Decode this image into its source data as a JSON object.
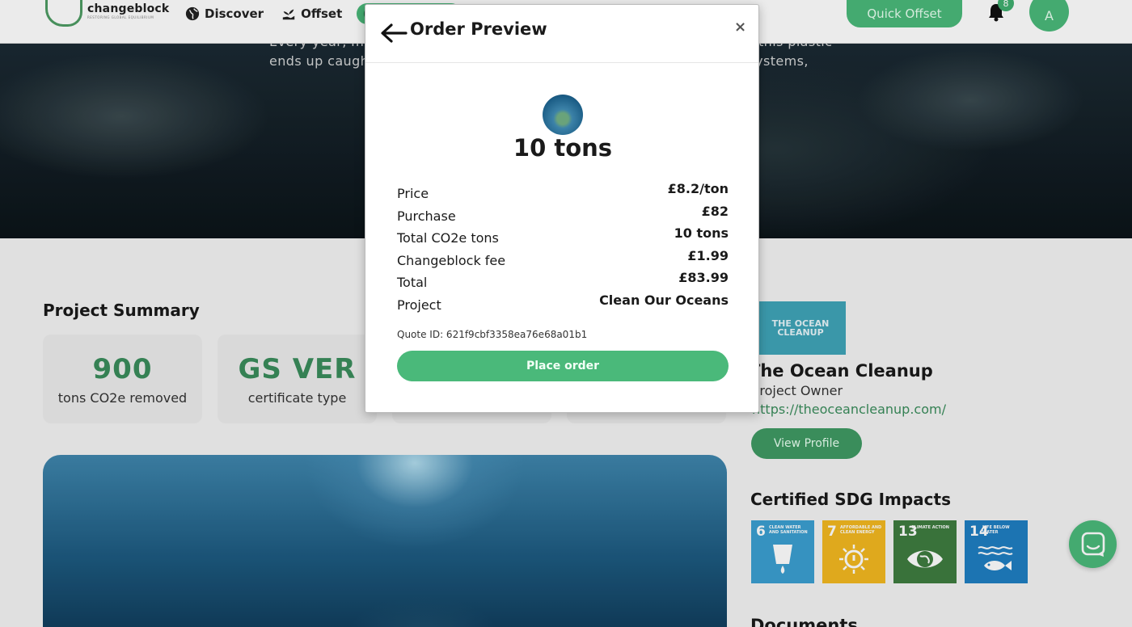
{
  "header": {
    "logo_name": "changeblock",
    "logo_tagline": "RESTORING GLOBAL EQUILIBRIUM",
    "nav": [
      {
        "label": "Discover",
        "icon": "globe-icon"
      },
      {
        "label": "Offset",
        "icon": "plant-hand-icon"
      }
    ],
    "quick_offset": "Quick Offset",
    "notification_count": "8",
    "avatar_initial": "A"
  },
  "hero": {
    "text": "Every year, millions of tons of plastic spills out from rivers. A portion of this plastic ends up caught in a vortex of circulating currents, threatening our ecosystems,"
  },
  "summary": {
    "title": "Project Summary",
    "stats": [
      {
        "value": "900",
        "label": "tons CO2e removed"
      },
      {
        "value": "GS VER",
        "label": "certificate type"
      },
      {
        "value": "",
        "label": ""
      },
      {
        "value": "",
        "label": ""
      }
    ]
  },
  "organization": {
    "logo_text": "THE OCEAN CLEANUP",
    "name": "The Ocean Cleanup",
    "role": "Project Owner",
    "url": "https://theoceancleanup.com/",
    "view_profile": "View Profile"
  },
  "sdg": {
    "title": "Certified SDG Impacts",
    "items": [
      {
        "number": "6",
        "label": "CLEAN WATER AND SANITATION",
        "color": "#3b9fd1",
        "icon": "water-drop-icon"
      },
      {
        "number": "7",
        "label": "AFFORDABLE AND CLEAN ENERGY",
        "color": "#f2b820",
        "icon": "sun-power-icon"
      },
      {
        "number": "13",
        "label": "CLIMATE ACTION",
        "color": "#3e7c3f",
        "icon": "eye-globe-icon"
      },
      {
        "number": "14",
        "label": "LIFE BELOW WATER",
        "color": "#1f7ec2",
        "icon": "fish-icon"
      }
    ]
  },
  "documents": {
    "title": "Documents"
  },
  "modal": {
    "title": "Order Preview",
    "close": "×",
    "tons": "10 tons",
    "rows": [
      {
        "label": "Price",
        "value": "£8.2/ton"
      },
      {
        "label": "Purchase",
        "value": "£82"
      },
      {
        "label": "Total CO2e tons",
        "value": "10 tons"
      },
      {
        "label": "Changeblock fee",
        "value": "£1.99"
      },
      {
        "label": "Total",
        "value": "£83.99"
      },
      {
        "label": "Project",
        "value": "Clean Our Oceans"
      }
    ],
    "quote_id": "Quote ID: 621f9cbf3358ea76e68a01b1",
    "place_order": "Place order"
  },
  "colors": {
    "brand_green": "#4ab97a",
    "dark_green": "#3a8d5c"
  }
}
